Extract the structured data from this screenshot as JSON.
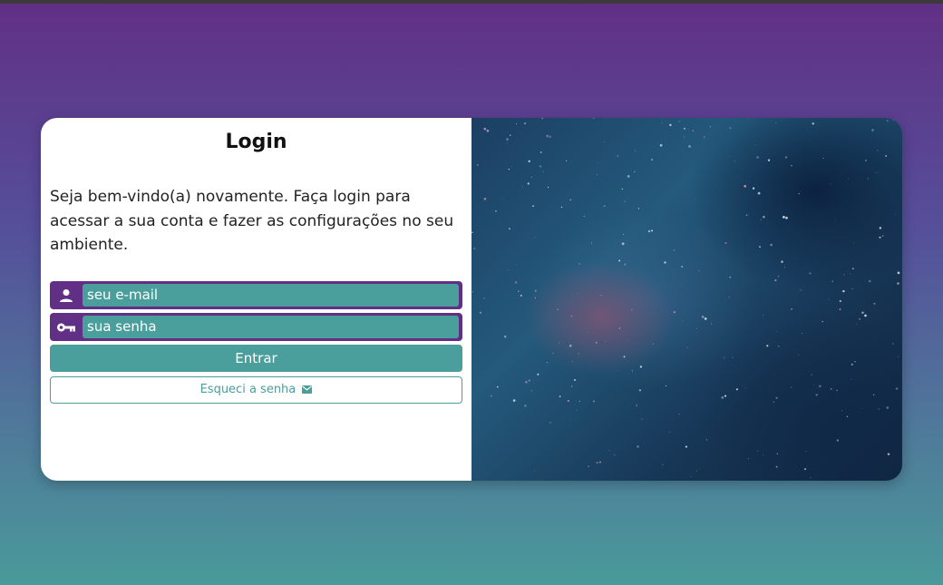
{
  "login": {
    "title": "Login",
    "intro": "Seja bem-vindo(a) novamente. Faça login para acessar a sua conta e fazer as configurações no seu ambiente.",
    "email": {
      "placeholder": "seu e-mail",
      "value": "seu e-mail",
      "icon": "user-icon"
    },
    "password": {
      "placeholder": "sua senha",
      "value": "sua senha",
      "icon": "key-icon"
    },
    "submit_label": "Entrar",
    "forgot_label": "Esqueci a senha",
    "forgot_icon": "mail-icon"
  },
  "image": {
    "description": "galaxy-nebula"
  },
  "colors": {
    "purple": "#612f86",
    "teal": "#4a9e9b",
    "white": "#ffffff"
  }
}
